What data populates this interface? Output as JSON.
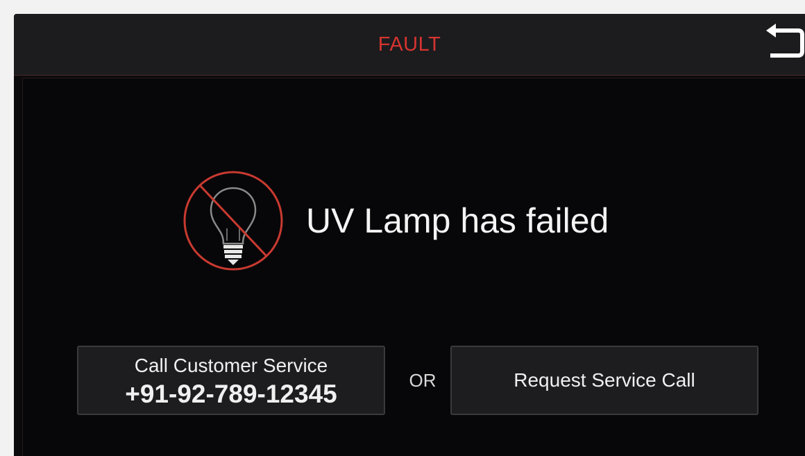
{
  "header": {
    "title": "FAULT",
    "title_color": "#d6342f",
    "back_icon": "return-arrow-icon"
  },
  "fault": {
    "icon": "uv-lamp-failed-icon",
    "icon_color": "#c93a30",
    "message": "UV Lamp has failed"
  },
  "actions": {
    "call": {
      "label": "Call Customer Service",
      "phone": "+91-92-789-12345"
    },
    "separator": "OR",
    "request": {
      "label": "Request Service Call"
    }
  },
  "colors": {
    "background": "#0a0a0c",
    "header_bg": "#1c1c1e",
    "button_bg": "#1d1d20",
    "text": "#f4f4f4"
  }
}
